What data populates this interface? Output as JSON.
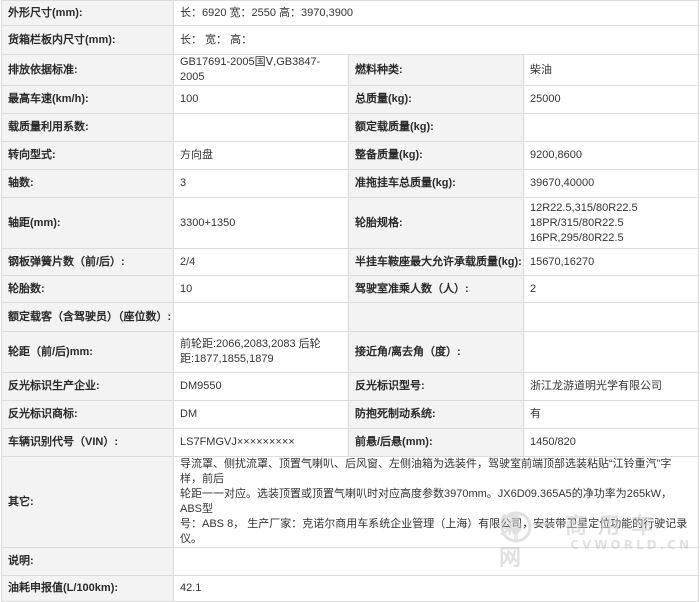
{
  "rows": [
    {
      "l1": "外形尺寸(mm):",
      "v1": "长：6920 宽：2550 高：3970,3900"
    },
    {
      "l1": "货箱栏板内尺寸(mm):",
      "v1": "长： 宽： 高："
    },
    {
      "l1": "排放依据标准:",
      "v1": "GB17691-2005国Ⅴ,GB3847-2005",
      "l2": "燃料种类:",
      "v2": "柴油"
    },
    {
      "l1": "最高车速(km/h):",
      "v1": "100",
      "l2": "总质量(kg):",
      "v2": "25000"
    },
    {
      "l1": "载质量利用系数:",
      "v1": "",
      "l2": "额定载质量(kg):",
      "v2": ""
    },
    {
      "l1": "转向型式:",
      "v1": "方向盘",
      "l2": "整备质量(kg):",
      "v2": "9200,8600"
    },
    {
      "l1": "轴数:",
      "v1": "3",
      "l2": "准拖挂车总质量(kg):",
      "v2": "39670,40000"
    },
    {
      "l1": "轴距(mm):",
      "v1": "3300+1350",
      "l2": "轮胎规格:",
      "v2_lines": [
        "12R22.5,315/80R22.5",
        "18PR/315/80R22.5",
        "16PR,295/80R22.5"
      ]
    },
    {
      "l1": "钢板弹簧片数（前/后）:",
      "v1": "2/4",
      "l2": "半挂车鞍座最大允许承载质量(kg):",
      "v2": "15670,16270"
    },
    {
      "l1": "轮胎数:",
      "v1": "10",
      "l2": "驾驶室准乘人数（人）:",
      "v2": "2"
    },
    {
      "l1": "额定载客（含驾驶员）（座位数）:",
      "v1": "",
      "l2": "",
      "v2": ""
    },
    {
      "l1": "轮距（前/后)mm:",
      "v1_lines": [
        "前轮距:2066,2083,2083 后轮",
        "距:1877,1855,1879"
      ],
      "l2": "接近角/离去角（度）:",
      "v2": ""
    },
    {
      "l1": "反光标识生产企业:",
      "v1": "DM9550",
      "l2": "反光标识型号:",
      "v2": "浙江龙游道明光学有限公司"
    },
    {
      "l1": "反光标识商标:",
      "v1": "DM",
      "l2": "防抱死制动系统:",
      "v2": "有"
    },
    {
      "l1": "车辆识别代号（VIN）:",
      "v1": "LS7FMGVJ×××××××××",
      "l2": "前悬/后悬(mm):",
      "v2": "1450/820"
    },
    {
      "l1": "其它:",
      "v1_lines": [
        "导流罩、侧扰流罩、顶置气喇叭、后风窗、左侧油箱为选装件，驾驶室前端顶部选装粘贴“江铃重汽”字样，前后",
        "轮距一一对应。选装顶置或顶置气喇叭时对应高度参数3970mm。JX6D09.365A5的净功率为265kW，ABS型",
        "号：ABS 8， 生产厂家：克诺尔商用车系统企业管理（上海）有限公司，安装带卫星定位功能的行驶记录仪。"
      ]
    },
    {
      "l1": "说明:",
      "v1": ""
    },
    {
      "l1": "油耗申报值(L/100km):",
      "v1": "42.1"
    }
  ],
  "watermark": {
    "cn": "第一商用车网",
    "en": "CVWORLD.CN"
  }
}
